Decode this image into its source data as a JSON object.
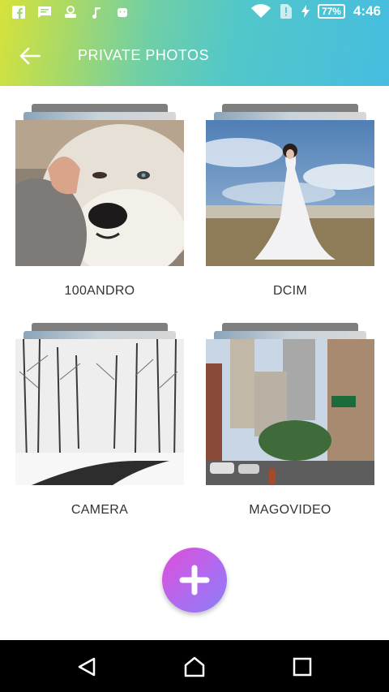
{
  "status_bar": {
    "battery": "77%",
    "time": "4:46"
  },
  "toolbar": {
    "title": "PRIVATE PHOTOS",
    "back_icon": "arrow-left-icon"
  },
  "folders": [
    {
      "name": "100ANDRO",
      "thumbnail": "husky-dog-photo"
    },
    {
      "name": "DCIM",
      "thumbnail": "woman-white-dress-photo"
    },
    {
      "name": "CAMERA",
      "thumbnail": "snowy-forest-road-photo"
    },
    {
      "name": "MAGOVIDEO",
      "thumbnail": "city-street-photo"
    }
  ],
  "fab": {
    "icon": "plus-icon"
  },
  "nav": {
    "back_icon": "triangle-back-icon",
    "home_icon": "home-icon",
    "recents_icon": "square-recents-icon"
  },
  "colors": {
    "accent_start": "#d6e23a",
    "accent_end": "#46bde0",
    "fab_start": "#e04ddb",
    "fab_end": "#8b7ef8"
  }
}
